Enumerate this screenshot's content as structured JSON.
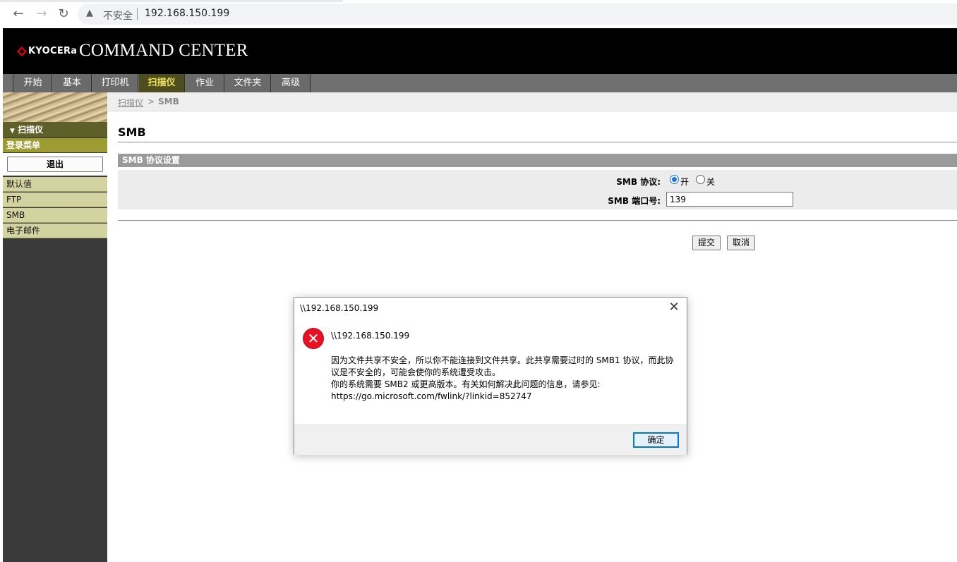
{
  "browser": {
    "insecure_label": "不安全",
    "url": "192.168.150.199"
  },
  "header": {
    "brand": "KYOCERa",
    "title": "COMMAND CENTER"
  },
  "tabs": [
    {
      "label": "开始"
    },
    {
      "label": "基本"
    },
    {
      "label": "打印机"
    },
    {
      "label": "扫描仪",
      "active": true
    },
    {
      "label": "作业"
    },
    {
      "label": "文件夹"
    },
    {
      "label": "高级"
    }
  ],
  "sidebar": {
    "section": "扫描仪",
    "login_menu": "登录菜单",
    "logout": "退出",
    "items": [
      {
        "label": "默认值"
      },
      {
        "label": "FTP"
      },
      {
        "label": "SMB"
      },
      {
        "label": "电子邮件"
      }
    ]
  },
  "breadcrumb": {
    "parent": "扫描仪",
    "separator": ">",
    "current": "SMB"
  },
  "page": {
    "title": "SMB",
    "section_header": "SMB 协议设置",
    "protocol_label": "SMB 协议:",
    "on_label": "开",
    "off_label": "关",
    "protocol_value": "开",
    "port_label": "SMB 端口号:",
    "port_value": "139",
    "submit": "提交",
    "cancel": "取消"
  },
  "dialog": {
    "title": "\\\\192.168.150.199",
    "heading": "\\\\192.168.150.199",
    "line1": "因为文件共享不安全，所以你不能连接到文件共享。此共享需要过时的 SMB1 协议，而此协",
    "line2": "议是不安全的，可能会使你的系统遭受攻击。",
    "line3": "你的系统需要 SMB2 或更高版本。有关如何解决此问题的信息，请参见:",
    "line4": "https://go.microsoft.com/fwlink/?linkid=852747",
    "ok": "确定",
    "close_glyph": "✕"
  },
  "colors": {
    "active_tab_text": "#f6e35a",
    "error_icon": "#e81123",
    "ok_border": "#0078d7"
  }
}
